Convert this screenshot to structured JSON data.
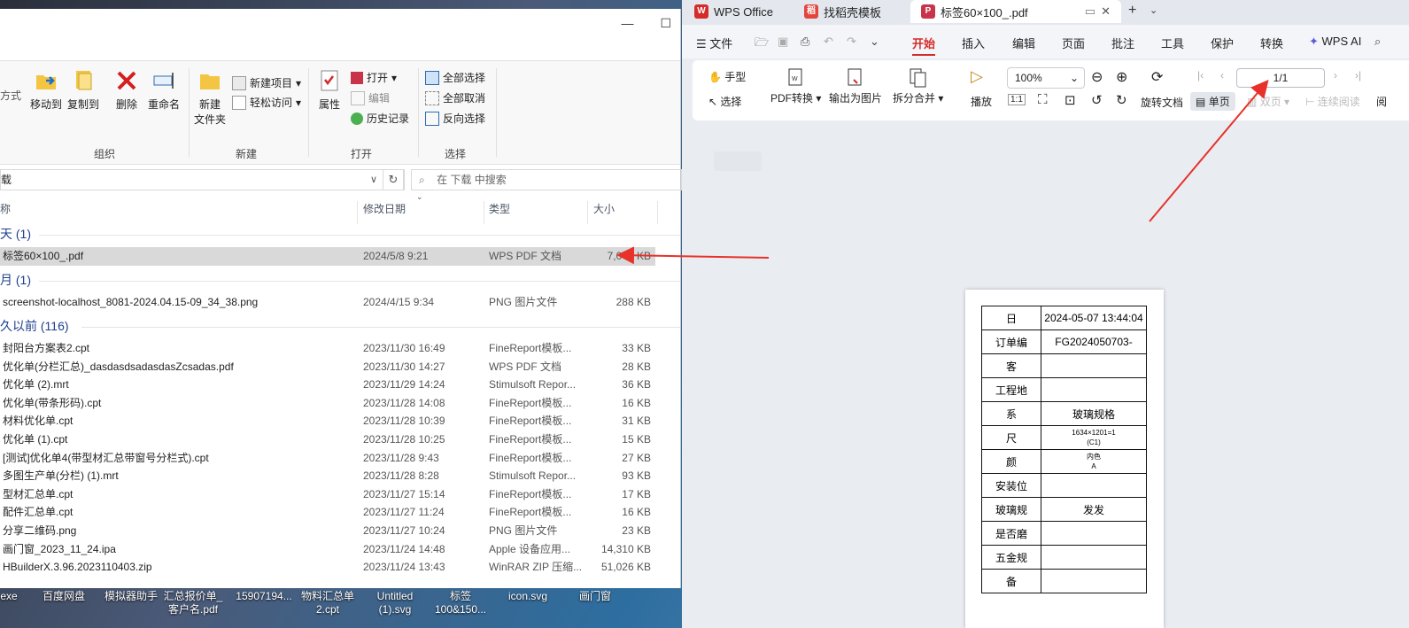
{
  "desktop": {
    "icons": [
      {
        "line1": "exe",
        "line2": ""
      },
      {
        "line1": "百度网盘",
        "line2": ""
      },
      {
        "line1": "模拟器助手",
        "line2": ""
      },
      {
        "line1": "汇总报价单_",
        "line2": "客户名.pdf"
      },
      {
        "line1": "15907194...",
        "line2": ""
      },
      {
        "line1": "物料汇总单",
        "line2": "2.cpt"
      },
      {
        "line1": "Untitled",
        "line2": "(1).svg"
      },
      {
        "line1": "标签",
        "line2": "100&150..."
      },
      {
        "line1": "icon.svg",
        "line2": ""
      },
      {
        "line1": "画门窗",
        "line2": ""
      }
    ]
  },
  "explorer": {
    "ribbon": {
      "organize": {
        "move_to": "移动到",
        "copy_to": "复制到",
        "delete": "删除",
        "rename": "重命名",
        "label": "组织"
      },
      "new": {
        "new_folder_l1": "新建",
        "new_folder_l2": "文件夹",
        "new_item": "新建项目",
        "easy_access": "轻松访问",
        "label": "新建"
      },
      "open": {
        "properties": "属性",
        "open": "打开",
        "edit": "编辑",
        "history": "历史记录",
        "label": "打开"
      },
      "select": {
        "select_all": "全部选择",
        "select_none": "全部取消",
        "invert": "反向选择",
        "label": "选择"
      },
      "left_partial": "方式"
    },
    "address_partial": "载",
    "search_placeholder": "在 下载 中搜索",
    "columns": {
      "name": "称",
      "date": "修改日期",
      "type": "类型",
      "size": "大小"
    },
    "groups": [
      {
        "title": "天 (1)",
        "files": [
          {
            "name": "标签60×100_.pdf",
            "date": "2024/5/8 9:21",
            "type": "WPS PDF 文档",
            "size": "7,048 KB",
            "selected": true
          }
        ]
      },
      {
        "title": "月 (1)",
        "files": [
          {
            "name": "screenshot-localhost_8081-2024.04.15-09_34_38.png",
            "date": "2024/4/15 9:34",
            "type": "PNG 图片文件",
            "size": "288 KB"
          }
        ]
      },
      {
        "title": "久以前 (116)",
        "files": [
          {
            "name": "封阳台方案表2.cpt",
            "date": "2023/11/30 16:49",
            "type": "FineReport模板...",
            "size": "33 KB"
          },
          {
            "name": "优化单(分栏汇总)_dasdasdsadasdasZcsadas.pdf",
            "date": "2023/11/30 14:27",
            "type": "WPS PDF 文档",
            "size": "28 KB"
          },
          {
            "name": "优化单 (2).mrt",
            "date": "2023/11/29 14:24",
            "type": "Stimulsoft Repor...",
            "size": "36 KB"
          },
          {
            "name": "优化单(带条形码).cpt",
            "date": "2023/11/28 14:08",
            "type": "FineReport模板...",
            "size": "16 KB"
          },
          {
            "name": "材料优化单.cpt",
            "date": "2023/11/28 10:39",
            "type": "FineReport模板...",
            "size": "31 KB"
          },
          {
            "name": "优化单 (1).cpt",
            "date": "2023/11/28 10:25",
            "type": "FineReport模板...",
            "size": "15 KB"
          },
          {
            "name": "[测试]优化单4(带型材汇总带窗号分栏式).cpt",
            "date": "2023/11/28 9:43",
            "type": "FineReport模板...",
            "size": "27 KB"
          },
          {
            "name": "多图生产单(分栏) (1).mrt",
            "date": "2023/11/28 8:28",
            "type": "Stimulsoft Repor...",
            "size": "93 KB"
          },
          {
            "name": "型材汇总单.cpt",
            "date": "2023/11/27 15:14",
            "type": "FineReport模板...",
            "size": "17 KB"
          },
          {
            "name": "配件汇总单.cpt",
            "date": "2023/11/27 11:24",
            "type": "FineReport模板...",
            "size": "16 KB"
          },
          {
            "name": "分享二维码.png",
            "date": "2023/11/27 10:24",
            "type": "PNG 图片文件",
            "size": "23 KB"
          },
          {
            "name": "画门窗_2023_11_24.ipa",
            "date": "2023/11/24 14:48",
            "type": "Apple 设备应用...",
            "size": "14,310 KB"
          },
          {
            "name": "HBuilderX.3.96.2023110403.zip",
            "date": "2023/11/24 13:43",
            "type": "WinRAR ZIP 压缩...",
            "size": "51,026 KB"
          }
        ]
      }
    ]
  },
  "wps": {
    "tabs": [
      {
        "label": "WPS Office",
        "logo": "W",
        "color": "#d42b2b"
      },
      {
        "label": "找稻壳模板",
        "logo": "稻",
        "color": "#e2463d"
      },
      {
        "label": "标签60×100_.pdf",
        "logo": "P",
        "color": "#c8354a"
      }
    ],
    "menu": {
      "file": "文件",
      "items": [
        "开始",
        "插入",
        "编辑",
        "页面",
        "批注",
        "工具",
        "保护",
        "转换"
      ],
      "ai": "WPS AI"
    },
    "toolbar": {
      "hand": "手型",
      "select": "选择",
      "pdf_convert": "PDF转换",
      "export_image": "输出为图片",
      "split_merge": "拆分合并",
      "zoom": "100%",
      "play": "播放",
      "rotate": "旋转文档",
      "page": "1/1",
      "single": "单页",
      "double": "双页",
      "continuous": "连续阅读",
      "read_partial": "阅"
    },
    "pdf_table": [
      {
        "k": "日",
        "v": "2024-05-07 13:44:04"
      },
      {
        "k": "订单编",
        "v": "FG2024050703-"
      },
      {
        "k": "客",
        "v": ""
      },
      {
        "k": "工程地",
        "v": ""
      },
      {
        "k": "系",
        "v": "玻璃规格"
      },
      {
        "k": "尺",
        "v": "1634×1201=1",
        "v2": "(C1)",
        "tiny": true
      },
      {
        "k": "颜",
        "v": "内色",
        "v2": "A",
        "tiny": true
      },
      {
        "k": "安装位",
        "v": ""
      },
      {
        "k": "玻璃规",
        "v": "发发"
      },
      {
        "k": "是否磨",
        "v": ""
      },
      {
        "k": "五金规",
        "v": ""
      },
      {
        "k": "备",
        "v": ""
      }
    ]
  },
  "colors": {
    "wps_red": "#d42b2b",
    "arrow_red": "#e8312a",
    "group_blue": "#1e3f8f"
  }
}
